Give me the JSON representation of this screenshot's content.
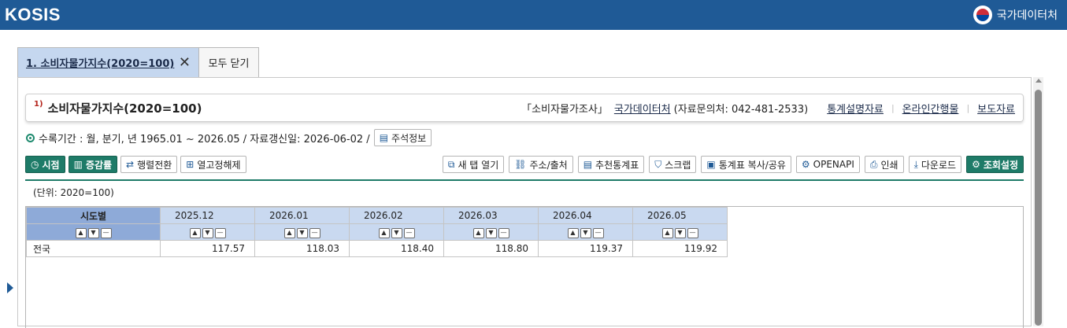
{
  "header": {
    "logo": "KOSIS",
    "brand": "국가데이터처"
  },
  "tabs": [
    {
      "label": "1. 소비자물가지수(2020=100)",
      "close": "✕"
    },
    {
      "label": "모두 닫기"
    }
  ],
  "title": {
    "footnote": "1)",
    "text": "소비자물가지수(2020=100)",
    "survey": "「소비자물가조사」",
    "org": "국가데이터처",
    "contact": "(자료문의처: 042-481-2533)",
    "links": [
      "통계설명자료",
      "온라인간행물",
      "보도자료"
    ]
  },
  "info": {
    "text": "수록기간 : 월, 분기, 년 1965.01 ~ 2026.05 / 자료갱신일: 2026-06-02 /",
    "notes_button": "주석정보"
  },
  "toolbar": {
    "left": [
      {
        "label": "시점",
        "icon": "clock-icon"
      },
      {
        "label": "증감률",
        "icon": "chart-icon"
      },
      {
        "label": "행렬전환",
        "icon": "swap-icon"
      },
      {
        "label": "열고정해제",
        "icon": "grid-icon"
      }
    ],
    "right": [
      {
        "label": "새 탭 열기",
        "icon": "new-tab-icon"
      },
      {
        "label": "주소/출처",
        "icon": "link-icon"
      },
      {
        "label": "추천통계표",
        "icon": "comment-icon"
      },
      {
        "label": "스크랩",
        "icon": "bookmark-icon"
      },
      {
        "label": "통계표 복사/공유",
        "icon": "copy-icon"
      },
      {
        "label": "OPENAPI",
        "icon": "api-icon"
      },
      {
        "label": "인쇄",
        "icon": "print-icon"
      },
      {
        "label": "다운로드",
        "icon": "download-icon"
      },
      {
        "label": "조회설정",
        "icon": "gear-icon"
      }
    ]
  },
  "unit": "(단위: 2020=100)",
  "table": {
    "row_header": "시도별",
    "columns": [
      "2025.12",
      "2026.01",
      "2026.02",
      "2026.03",
      "2026.04",
      "2026.05"
    ],
    "rows": [
      {
        "label": "전국",
        "values": [
          "117.57",
          "118.03",
          "118.40",
          "118.80",
          "119.37",
          "119.92"
        ]
      }
    ]
  }
}
